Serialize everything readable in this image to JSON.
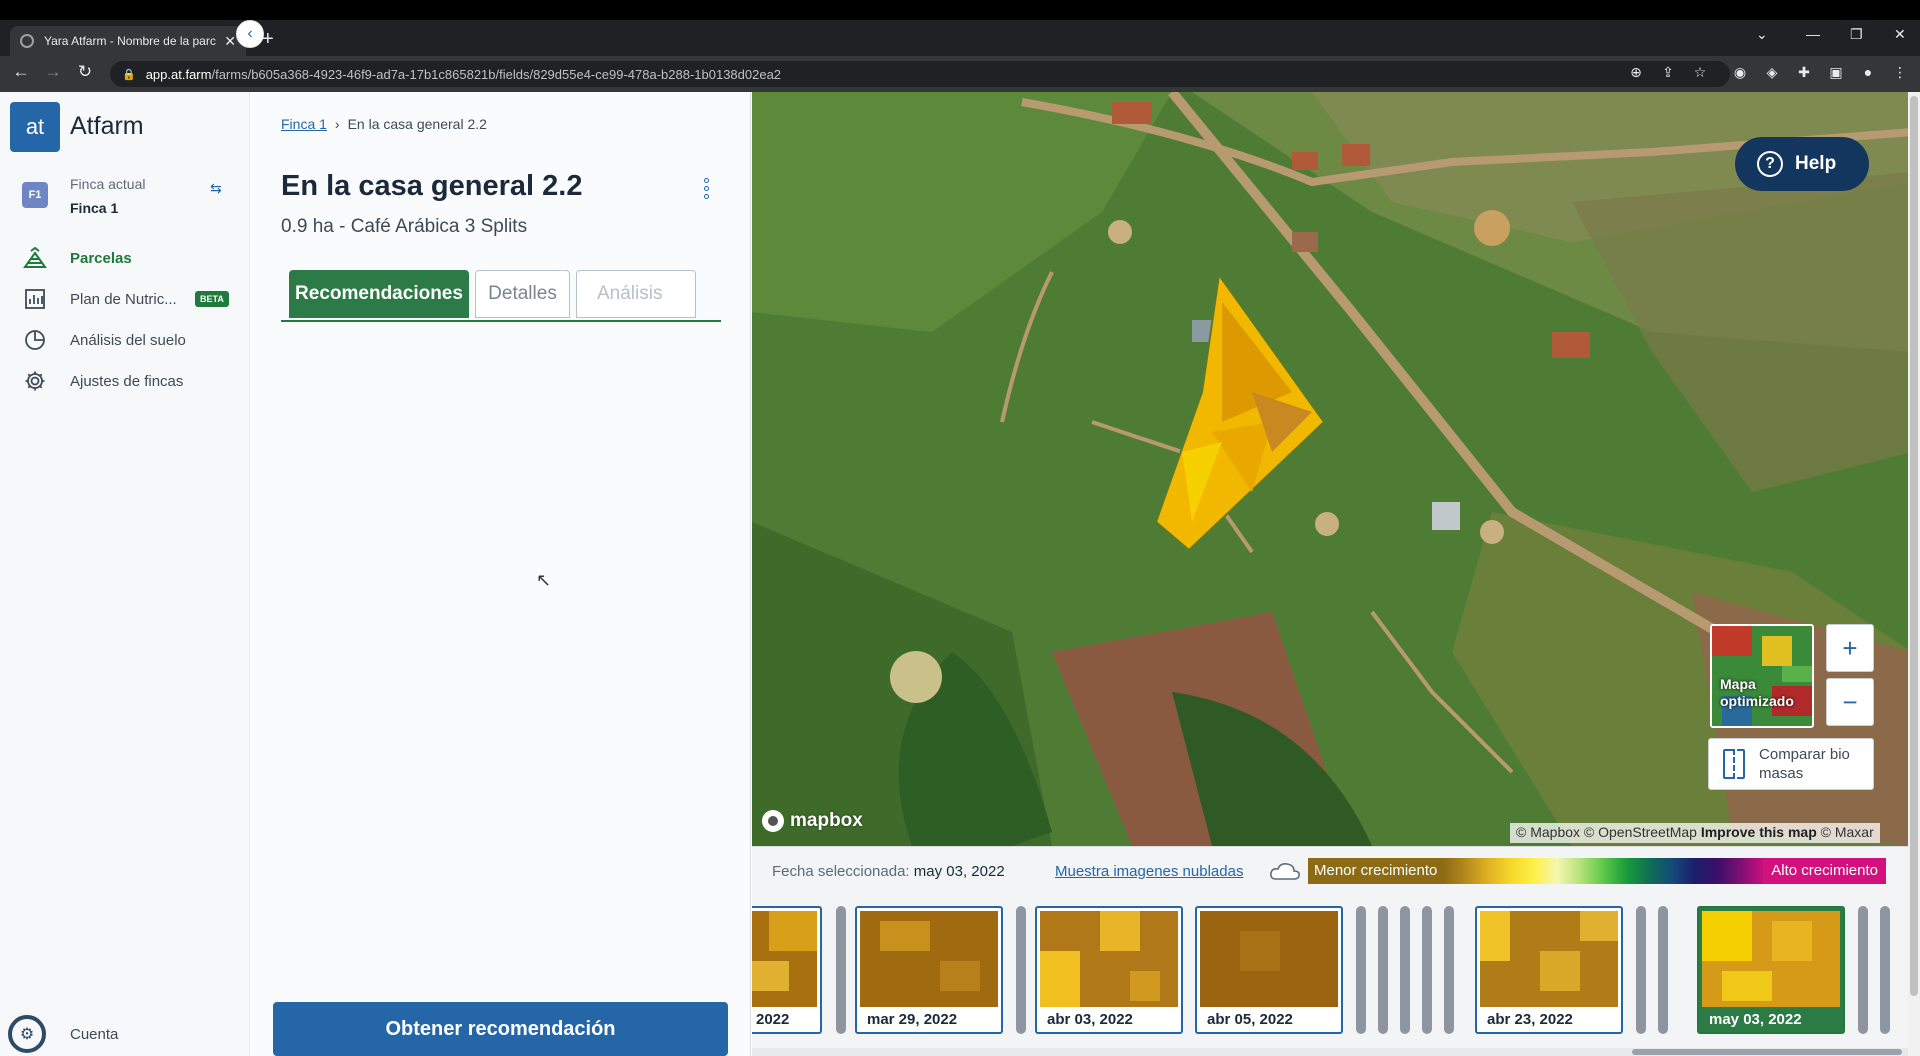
{
  "browser": {
    "tab_title": "Yara Atfarm - Nombre de la parc",
    "url_host": "app.at.farm",
    "url_path": "/farms/b605a368-4923-46f9-ad7a-17b1c865821b/fields/829d55e4-ce99-478a-b288-1b0138d02ea2"
  },
  "sidebar": {
    "logo_text": "at",
    "brand": "Atfarm",
    "farm_badge": "F1",
    "farm_caption": "Finca actual",
    "farm_name": "Finca 1",
    "items": [
      {
        "label": "Parcelas",
        "icon": "field-icon",
        "active": true
      },
      {
        "label": "Plan de Nutric...",
        "icon": "chart-icon",
        "badge": "BETA"
      },
      {
        "label": "Análisis del suelo",
        "icon": "pie-icon"
      },
      {
        "label": "Ajustes de fincas",
        "icon": "gear-icon"
      }
    ],
    "account_label": "Cuenta"
  },
  "panel": {
    "breadcrumb_link": "Finca 1",
    "breadcrumb_current": "En la casa general 2.2",
    "title": "En la casa general 2.2",
    "subtitle": "0.9 ha - Café Arábica 3 Splits",
    "tabs": [
      "Recomendaciones",
      "Detalles",
      "Análisis"
    ],
    "cta": "Obtener recomendación"
  },
  "map": {
    "help": "Help",
    "layer_label": "Mapa optimizado",
    "zoom_in": "+",
    "zoom_out": "−",
    "compare_label": "Comparar bio masas",
    "mapbox": "mapbox",
    "attribution_1": "© Mapbox © OpenStreetMap",
    "attribution_2": "Improve this map",
    "attribution_3": "© Maxar"
  },
  "timeline": {
    "selected_prefix": "Fecha seleccionada:",
    "selected_date": "may 03, 2022",
    "cloud_link": "Muestra imagenes nubladas",
    "legend_low": "Menor crecimiento",
    "legend_high": "Alto crecimiento",
    "frames": [
      "2022",
      "mar 29, 2022",
      "abr 03, 2022",
      "abr 05, 2022",
      "abr 23, 2022",
      "may 03, 2022"
    ],
    "selected_frame_index": 5
  },
  "colors": {
    "brand_blue": "#2566a8",
    "accent_green": "#2c7a45",
    "navy": "#12365e"
  }
}
